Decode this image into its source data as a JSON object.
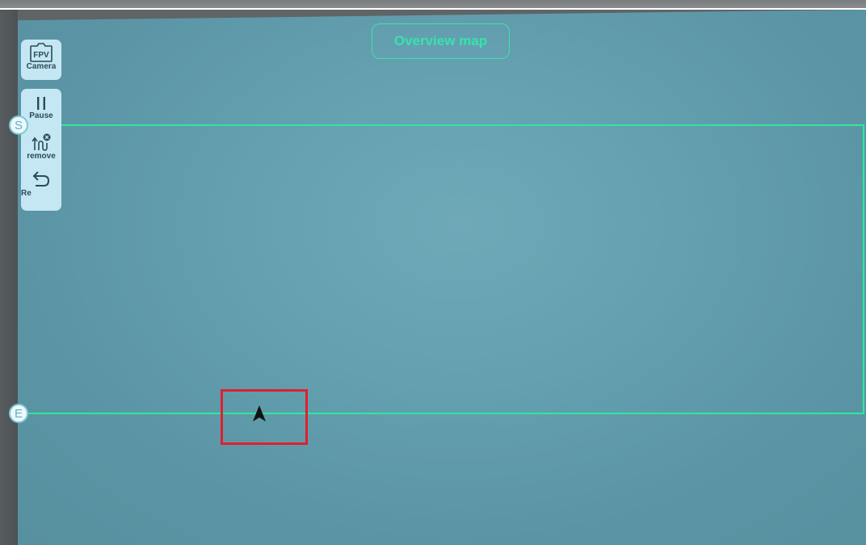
{
  "header": {
    "title": "Overview map"
  },
  "toolbar": {
    "camera": {
      "icon_text": "FPV",
      "label": "Camera",
      "icon": "fpv-camera-icon"
    },
    "pause": {
      "label": "Pause",
      "icon": "pause-icon"
    },
    "remove": {
      "label": "remove",
      "icon": "remove-route-icon"
    },
    "re": {
      "label": "Re",
      "icon": "undo-icon"
    }
  },
  "route": {
    "start_label": "S",
    "end_label": "E",
    "line_color": "#2ee89a"
  },
  "drone": {
    "icon": "navigation-arrow-icon",
    "highlight_color": "#e0202c"
  }
}
